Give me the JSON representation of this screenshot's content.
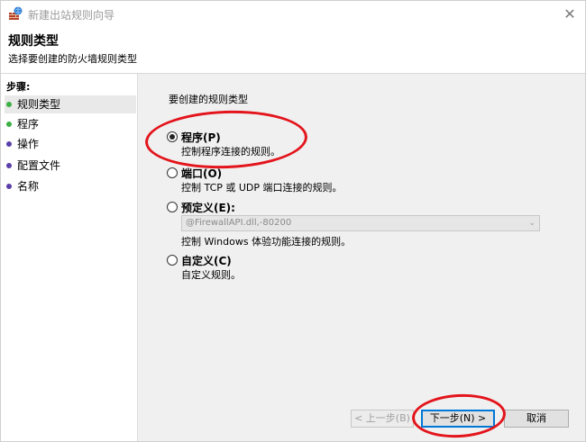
{
  "window": {
    "title": "新建出站规则向导",
    "close_glyph": "✕"
  },
  "header": {
    "title": "规则类型",
    "subtitle": "选择要创建的防火墙规则类型"
  },
  "steps": {
    "label": "步骤:",
    "items": [
      {
        "label": "规则类型",
        "dot_color": "#3cb043"
      },
      {
        "label": "程序",
        "dot_color": "#3cb043"
      },
      {
        "label": "操作",
        "dot_color": "#5b3fa8"
      },
      {
        "label": "配置文件",
        "dot_color": "#5b3fa8"
      },
      {
        "label": "名称",
        "dot_color": "#5b3fa8"
      }
    ]
  },
  "main": {
    "question": "要创建的规则类型",
    "options": [
      {
        "label": "程序(P)",
        "desc": "控制程序连接的规则。",
        "checked": true
      },
      {
        "label": "端口(O)",
        "desc": "控制 TCP 或 UDP 端口连接的规则。",
        "checked": false
      },
      {
        "label": "预定义(E):",
        "desc": "控制 Windows 体验功能连接的规则。",
        "checked": false
      },
      {
        "label": "自定义(C)",
        "desc": "自定义规则。",
        "checked": false
      }
    ],
    "predefined_value": "@FirewallAPI.dll,-80200",
    "combo_arrow": "⌄"
  },
  "buttons": {
    "back": "< 上一步(B)",
    "next": "下一步(N) >",
    "cancel": "取消"
  },
  "colors": {
    "annotation": "#e3141b",
    "primary_border": "#0078d7"
  }
}
